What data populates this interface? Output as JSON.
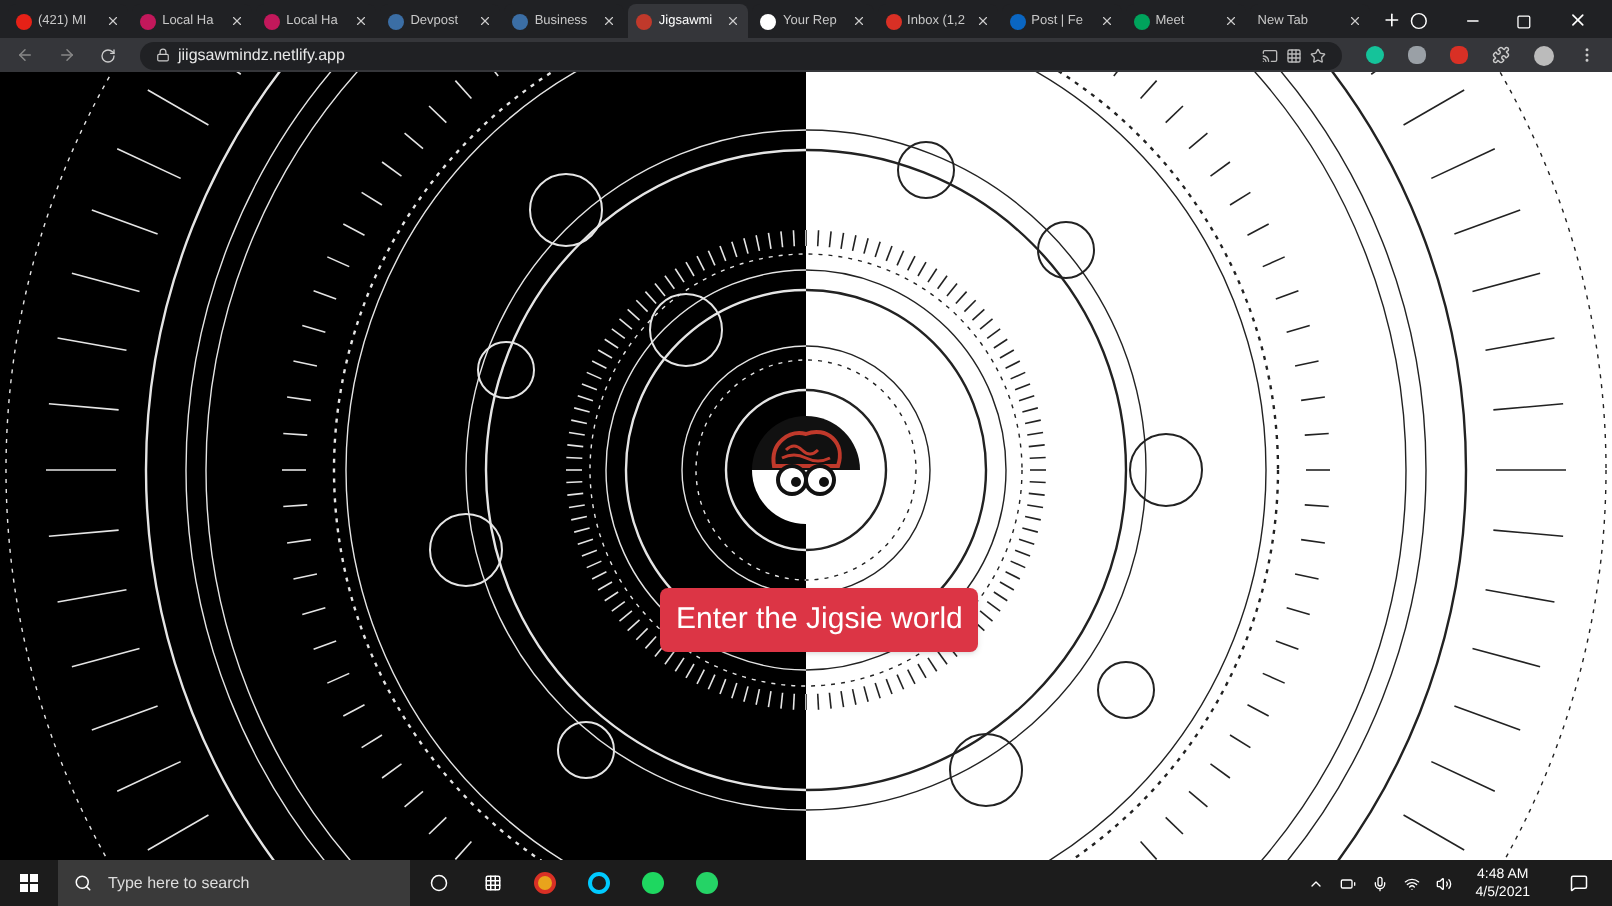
{
  "tabs": [
    {
      "title": "(421) MI",
      "kind": "video",
      "selected": false
    },
    {
      "title": "Local Ha",
      "kind": "sparkle",
      "selected": false
    },
    {
      "title": "Local Ha",
      "kind": "sparkle",
      "selected": false
    },
    {
      "title": "Devpost",
      "kind": "letter",
      "selected": false
    },
    {
      "title": "Business",
      "kind": "letter",
      "selected": false
    },
    {
      "title": "Jigsawmi",
      "kind": "mascot",
      "selected": true
    },
    {
      "title": "Your Rep",
      "kind": "octocat",
      "selected": false
    },
    {
      "title": "Inbox (1,2",
      "kind": "mail",
      "selected": false
    },
    {
      "title": "Post | Fe",
      "kind": "social",
      "selected": false
    },
    {
      "title": "Meet",
      "kind": "camera",
      "selected": false
    },
    {
      "title": "New Tab",
      "kind": "blank",
      "selected": false
    }
  ],
  "address_bar": {
    "url": "jiigsawmindz.netlify.app"
  },
  "page": {
    "button": "Enter the Jigsie world"
  },
  "taskbar": {
    "search_placeholder": "Type here to search",
    "time": "4:48 AM",
    "date": "4/5/2021"
  }
}
